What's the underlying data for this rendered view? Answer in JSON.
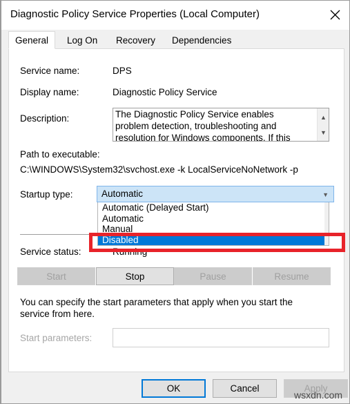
{
  "window": {
    "title": "Diagnostic Policy Service Properties (Local Computer)",
    "close_icon": "close-icon"
  },
  "tabs": [
    {
      "label": "General",
      "active": true
    },
    {
      "label": "Log On",
      "active": false
    },
    {
      "label": "Recovery",
      "active": false
    },
    {
      "label": "Dependencies",
      "active": false
    }
  ],
  "general": {
    "service_name_label": "Service name:",
    "service_name_value": "DPS",
    "display_name_label": "Display name:",
    "display_name_value": "Diagnostic Policy Service",
    "description_label": "Description:",
    "description_value": "The Diagnostic Policy Service enables problem detection, troubleshooting and resolution for Windows components. If this service is stopped",
    "path_label": "Path to executable:",
    "path_value": "C:\\WINDOWS\\System32\\svchost.exe -k LocalServiceNoNetwork -p",
    "startup_type_label": "Startup type:",
    "startup_type_value": "Automatic",
    "startup_type_options": [
      "Automatic (Delayed Start)",
      "Automatic",
      "Manual",
      "Disabled"
    ],
    "startup_type_selected": "Disabled",
    "service_status_label": "Service status:",
    "service_status_value": "Running"
  },
  "control_buttons": [
    {
      "label": "Start",
      "enabled": false
    },
    {
      "label": "Stop",
      "enabled": true
    },
    {
      "label": "Pause",
      "enabled": false
    },
    {
      "label": "Resume",
      "enabled": false
    }
  ],
  "parameters": {
    "hint": "You can specify the start parameters that apply when you start the service from here.",
    "label": "Start parameters:",
    "value": "",
    "placeholder": ""
  },
  "footer": {
    "ok_label": "OK",
    "cancel_label": "Cancel",
    "apply_label": "Apply"
  },
  "annotation": {
    "highlight_color": "#e8232a",
    "target": "Disabled"
  },
  "watermark": "wsxdn.com"
}
